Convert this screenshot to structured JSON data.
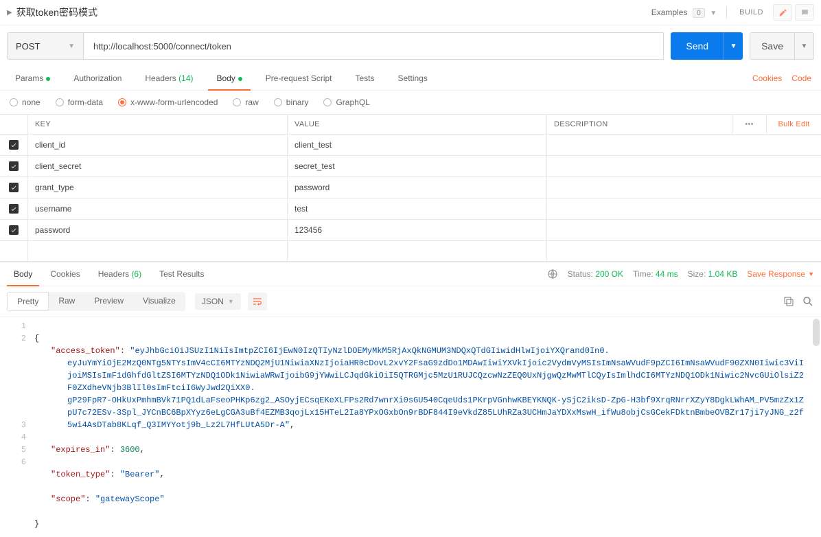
{
  "topbar": {
    "title": "获取token密码模式",
    "examples_label": "Examples",
    "examples_count": "0",
    "build_label": "BUILD"
  },
  "request": {
    "method": "POST",
    "url": "http://localhost:5000/connect/token",
    "send_label": "Send",
    "save_label": "Save"
  },
  "req_tabs": {
    "params": "Params",
    "authorization": "Authorization",
    "headers": "Headers",
    "headers_count": "(14)",
    "body": "Body",
    "prerequest": "Pre-request Script",
    "tests": "Tests",
    "settings": "Settings",
    "cookies_link": "Cookies",
    "code_link": "Code"
  },
  "body_types": {
    "none": "none",
    "form_data": "form-data",
    "urlencoded": "x-www-form-urlencoded",
    "raw": "raw",
    "binary": "binary",
    "graphql": "GraphQL"
  },
  "kv": {
    "header_key": "KEY",
    "header_value": "VALUE",
    "header_desc": "DESCRIPTION",
    "bulk_edit": "Bulk Edit",
    "rows": [
      {
        "key": "client_id",
        "value": "client_test"
      },
      {
        "key": "client_secret",
        "value": "secret_test"
      },
      {
        "key": "grant_type",
        "value": "password"
      },
      {
        "key": "username",
        "value": "test"
      },
      {
        "key": "password",
        "value": "123456"
      }
    ]
  },
  "resp_tabs": {
    "body": "Body",
    "cookies": "Cookies",
    "headers": "Headers",
    "headers_count": "(6)",
    "test_results": "Test Results"
  },
  "resp_meta": {
    "status_label": "Status:",
    "status_value": "200 OK",
    "time_label": "Time:",
    "time_value": "44 ms",
    "size_label": "Size:",
    "size_value": "1.04 KB",
    "save_response": "Save Response"
  },
  "viewer": {
    "pretty": "Pretty",
    "raw": "Raw",
    "preview": "Preview",
    "visualize": "Visualize",
    "lang": "JSON"
  },
  "response_body": {
    "access_token_line1": "eyJhbGciOiJSUzI1NiIsImtpZCI6IjEwN0IzQTIyNzlDOEMyMkM5RjAxQkNGMUM3NDQxQTdGIiwidHlwIjoiYXQrand0In0.",
    "access_token_line2": "eyJuYmYiOjE2MzQ0NTg5NTYsImV4cCI6MTYzNDQ2MjU1NiwiaXNzIjoiaHR0cDovL2xvY2FsaG9zdDo1MDAwIiwiYXVkIjoic2VydmVyMSIsImNsaWVudF9pZCI6ImNsaWVudF90ZXN0Iiwic3ViIjoiMSIsImF1dGhfdGltZSI6MTYzNDQ1ODk1NiwiaWRwIjoibG9jYWwiLCJqdGkiOiI5QTRGMjc5MzU1RUJCQzcwNzZEQ0UxNjgwQzMwMTlCQyIsImlhdCI6MTYzNDQ1ODk1Niwic2NvcGUiOlsiZ2F0ZXdheVNjb3BlIl0sImFtciI6WyJwd2QiXX0.",
    "access_token_line3": "gP29FpR7-OHkUxPmhmBVk71PQ1dLaFseoPHKp6zg2_ASOyjECsqEKeXLFPs2Rd7wnrXi0sGU540CqeUds1PKrpVGnhwKBEYKNQK-ySjC2iksD-ZpG-H3bf9XrqRNrrXZyY8DgkLWhAM_PV5mzZx1ZpU7c72ESv-3Spl_JYCnBC6BpXYyz6eLgCGA3uBf4EZMB3qojLx15HTeL2Ia8YPxOGxbOn9rBDF844I9eVkdZ85LUhRZa3UCHmJaYDXxMswH_ifWu8objCsGCekFDktnBmbeOVBZr17ji7yJNG_z2f5wi4AsDTab8KLqf_Q3IMYYotj9b_Lz2L7HfLUtA5Dr-A",
    "expires_in": 3600,
    "token_type": "Bearer",
    "scope": "gatewayScope"
  }
}
